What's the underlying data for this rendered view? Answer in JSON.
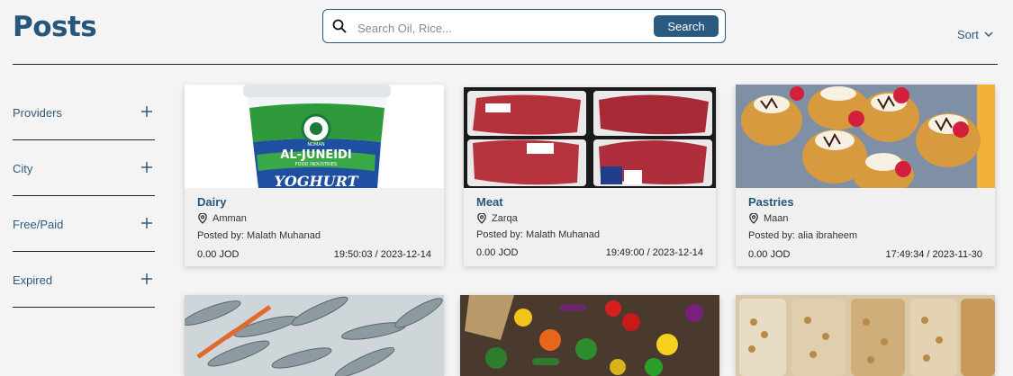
{
  "header": {
    "title": "Posts",
    "search_placeholder": "Search Oil, Rice...",
    "search_button": "Search",
    "sort_label": "Sort"
  },
  "filters": [
    {
      "label": "Providers",
      "icon": "plus-icon"
    },
    {
      "label": "City",
      "icon": "plus-icon"
    },
    {
      "label": "Free/Paid",
      "icon": "plus-icon"
    },
    {
      "label": "Expired",
      "icon": "plus-icon"
    }
  ],
  "posts": [
    {
      "title": "Dairy",
      "city": "Amman",
      "posted_by": "Posted by: Malath Muhanad",
      "price": "0.00 JOD",
      "datetime": "19:50:03 / 2023-12-14",
      "image_text": [
        "NOMAN",
        "AL-JUNEIDI",
        "FOOD INDUSTRIES",
        "YOGHURT"
      ]
    },
    {
      "title": "Meat",
      "city": "Zarqa",
      "posted_by": "Posted by: Malath Muhanad",
      "price": "0.00 JOD",
      "datetime": "19:49:00 / 2023-12-14"
    },
    {
      "title": "Pastries",
      "city": "Maan",
      "posted_by": "Posted by: alia ibraheem",
      "price": "0.00 JOD",
      "datetime": "17:49:34 / 2023-11-30"
    }
  ],
  "colors": {
    "accent": "#26577a",
    "button": "#2b5a80",
    "background": "#f4f4f4"
  }
}
